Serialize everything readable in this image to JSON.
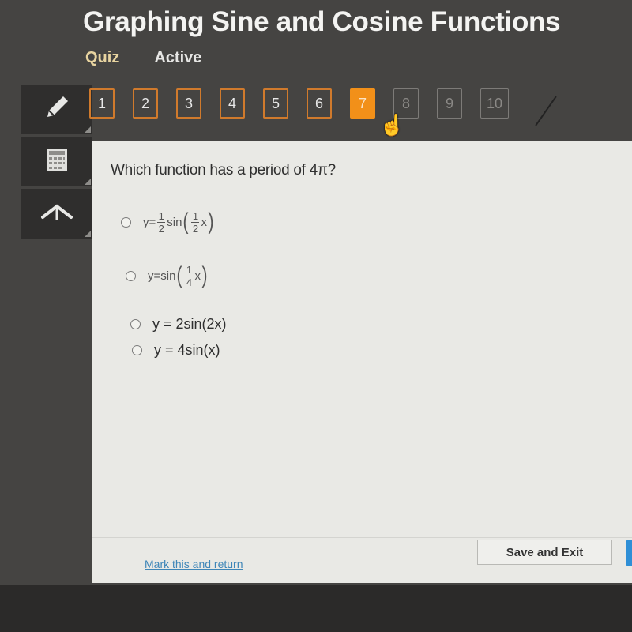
{
  "header": {
    "title": "Graphing Sine and Cosine Functions",
    "subnav": {
      "quiz_label": "Quiz",
      "status_label": "Active"
    }
  },
  "question_nav": {
    "items": [
      {
        "label": "1",
        "state": "answered"
      },
      {
        "label": "2",
        "state": "answered"
      },
      {
        "label": "3",
        "state": "answered"
      },
      {
        "label": "4",
        "state": "answered"
      },
      {
        "label": "5",
        "state": "answered"
      },
      {
        "label": "6",
        "state": "answered"
      },
      {
        "label": "7",
        "state": "current"
      },
      {
        "label": "8",
        "state": "locked"
      },
      {
        "label": "9",
        "state": "locked"
      },
      {
        "label": "10",
        "state": "locked"
      }
    ],
    "current_color": "#f29019",
    "answered_border_color": "#d07a2c"
  },
  "tools": [
    {
      "name": "pencil",
      "icon": "pencil-icon"
    },
    {
      "name": "calculator",
      "icon": "calculator-icon"
    },
    {
      "name": "collapse",
      "icon": "arrow-up-icon"
    }
  ],
  "question": {
    "text": "Which function has a period of 4π?",
    "options": [
      {
        "prefix": "y=",
        "coef_num": "1",
        "coef_den": "2",
        "func": "sin",
        "arg_num": "1",
        "arg_den": "2",
        "var": "x"
      },
      {
        "prefix": "y=sin",
        "arg_num": "1",
        "arg_den": "4",
        "var": "x"
      },
      {
        "text": "y = 2sin(2x)"
      },
      {
        "text": "y = 4sin(x)"
      }
    ]
  },
  "footer": {
    "mark_link": "Mark this and return",
    "save_exit": "Save and Exit"
  }
}
